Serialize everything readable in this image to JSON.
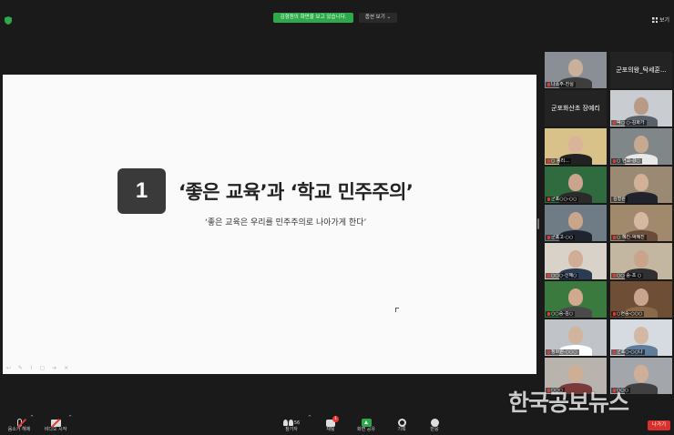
{
  "topbar": {
    "share_notice": "김형원의 화면을 보고 있습니다.",
    "view_options": "옵션 보기 ⌄",
    "view_button": "보기"
  },
  "slide": {
    "number": "1",
    "title": "‘좋은 교육’과 ‘학교 민주주의’",
    "subtitle": "‘좋은 교육은 우리를 민주주의로 나아가게 한다’",
    "tools": "↩ ✎ ⌇ ▢ ➔ ✕"
  },
  "participants": [
    {
      "name": "나소주-진실",
      "bg": "#8a8f95",
      "face": "#c9b09a",
      "body": "#3d3d3d",
      "muted": true
    },
    {
      "name": "군포의왕_탁세훈...",
      "center": true,
      "bg": "#232323",
      "muted": false
    },
    {
      "name": "군포화산초 장예리",
      "center": true,
      "bg": "#232323",
      "muted": false
    },
    {
      "name": "박○ ○-김화가",
      "bg": "#c9ccd0",
      "face": "#b79b86",
      "body": "#58606a",
      "muted": true
    },
    {
      "name": "○ 봉리...",
      "bg": "#d9c28a",
      "face": "#d9b49a",
      "body": "#222222",
      "muted": true
    },
    {
      "name": "○ 현교-강○",
      "bg": "#7f8788",
      "face": "#c7a891",
      "body": "#e8e8e8",
      "muted": true
    },
    {
      "name": "군포○○-○○",
      "bg": "#2f6b3f",
      "face": "#caa48c",
      "body": "#2b2b2b",
      "muted": true,
      "active": true
    },
    {
      "name": "김형원",
      "bg": "#9a8a74",
      "face": "#d2b197",
      "body": "#20242c",
      "muted": false,
      "active": true
    },
    {
      "name": "군포고-○○",
      "bg": "#6f7c86",
      "face": "#c9a58c",
      "body": "#1f2530",
      "muted": true
    },
    {
      "name": "○ 혜진-박혜진",
      "bg": "#a18a6c",
      "face": "#d7b8a3",
      "body": "#6b4b3a",
      "muted": true
    },
    {
      "name": "○○○-신혜○",
      "bg": "#d8d2c8",
      "face": "#d0ad94",
      "body": "#2a3b52",
      "muted": true
    },
    {
      "name": "○○ 중-초 ○",
      "bg": "#c4b7a2",
      "face": "#caa48a",
      "body": "#303030",
      "muted": true
    },
    {
      "name": "○○중-김○",
      "bg": "#3a7a3e",
      "face": "#d0a98e",
      "body": "#4a4a4a",
      "muted": true,
      "active": true
    },
    {
      "name": "○현중-○○○",
      "bg": "#6e4f36",
      "face": "#caa58c",
      "body": "#8a6a4a",
      "muted": true
    },
    {
      "name": "정화원-○○○",
      "bg": "#c0c4c8",
      "face": "#d1b49c",
      "body": "#ffffff",
      "muted": true
    },
    {
      "name": "군포○-○○나",
      "bg": "#d5dbe0",
      "face": "#d5b8a1",
      "body": "#5f7d9b",
      "muted": true
    },
    {
      "name": "○○○",
      "bg": "#b9b3ad",
      "face": "#cfae96",
      "body": "#7a3a3a",
      "muted": true
    },
    {
      "name": "○○○",
      "bg": "#a3a7ab",
      "face": "#cfaf98",
      "body": "#404040",
      "muted": true
    }
  ],
  "toolbar": {
    "audio_label": "음소거 해제",
    "video_label": "비디오 시작",
    "participants_count": "56",
    "participants_label": "참가자",
    "chat_badge": "1",
    "chat_label": "채팅",
    "share_label": "화면 공유",
    "record_label": "기록",
    "reactions_label": "반응",
    "leave_label": "나가기"
  },
  "watermark": "한국공보뉴스",
  "colors": {
    "background": "#1a1a1a",
    "share_green": "#2da84a",
    "leave_red": "#d8302a",
    "slide_bg": "#fafafa",
    "number_box": "#3a3a3a"
  }
}
